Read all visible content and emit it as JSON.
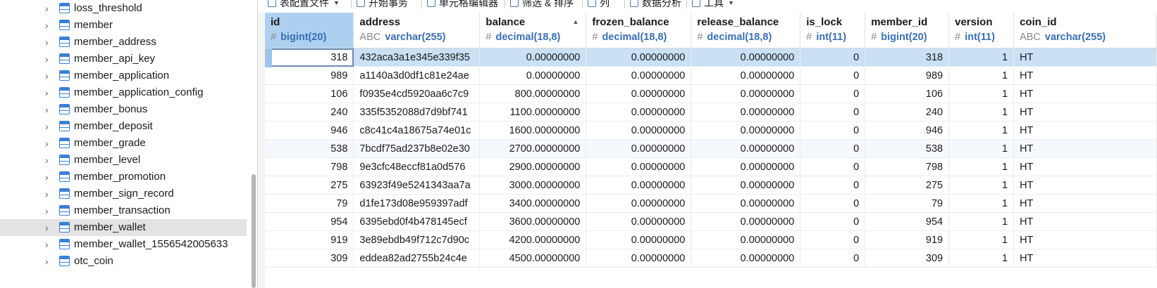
{
  "sidebar": {
    "items": [
      {
        "label": "loss_threshold",
        "selected": false
      },
      {
        "label": "member",
        "selected": false
      },
      {
        "label": "member_address",
        "selected": false
      },
      {
        "label": "member_api_key",
        "selected": false
      },
      {
        "label": "member_application",
        "selected": false
      },
      {
        "label": "member_application_config",
        "selected": false
      },
      {
        "label": "member_bonus",
        "selected": false
      },
      {
        "label": "member_deposit",
        "selected": false
      },
      {
        "label": "member_grade",
        "selected": false
      },
      {
        "label": "member_level",
        "selected": false
      },
      {
        "label": "member_promotion",
        "selected": false
      },
      {
        "label": "member_sign_record",
        "selected": false
      },
      {
        "label": "member_transaction",
        "selected": false
      },
      {
        "label": "member_wallet",
        "selected": true
      },
      {
        "label": "member_wallet_1556542005633",
        "selected": false
      },
      {
        "label": "otc_coin",
        "selected": false
      }
    ]
  },
  "toolbar": {
    "items": [
      {
        "label": "表配置文件",
        "icon": "config-file-icon",
        "dropdown": true
      },
      {
        "label": "开始事务",
        "icon": "transaction-icon",
        "dropdown": false
      },
      {
        "label": "单元格编辑器",
        "icon": "cell-editor-icon",
        "dropdown": false
      },
      {
        "label": "筛选 & 排序",
        "icon": "filter-icon",
        "dropdown": false
      },
      {
        "label": "列",
        "icon": "columns-icon",
        "dropdown": false
      },
      {
        "label": "数据分析",
        "icon": "analysis-icon",
        "dropdown": false
      },
      {
        "label": "工具",
        "icon": "tools-icon",
        "dropdown": true
      }
    ]
  },
  "grid": {
    "columns": [
      {
        "name": "id",
        "type": "bigint(20)",
        "type_icon": "#"
      },
      {
        "name": "address",
        "type": "varchar(255)",
        "type_icon": "ABC"
      },
      {
        "name": "balance",
        "type": "decimal(18,8)",
        "type_icon": "#",
        "sorted": "asc"
      },
      {
        "name": "frozen_balance",
        "type": "decimal(18,8)",
        "type_icon": "#"
      },
      {
        "name": "release_balance",
        "type": "decimal(18,8)",
        "type_icon": "#"
      },
      {
        "name": "is_lock",
        "type": "int(11)",
        "type_icon": "#"
      },
      {
        "name": "member_id",
        "type": "bigint(20)",
        "type_icon": "#"
      },
      {
        "name": "version",
        "type": "int(11)",
        "type_icon": "#"
      },
      {
        "name": "coin_id",
        "type": "varchar(255)",
        "type_icon": "ABC"
      }
    ],
    "rows": [
      [
        "318",
        "432aca3a1e345e339f35",
        "0.00000000",
        "0.00000000",
        "0.00000000",
        "0",
        "318",
        "1",
        "HT"
      ],
      [
        "989",
        "a1140a3d0df1c81e24ae",
        "0.00000000",
        "0.00000000",
        "0.00000000",
        "0",
        "989",
        "1",
        "HT"
      ],
      [
        "106",
        "f0935e4cd5920aa6c7c9",
        "800.00000000",
        "0.00000000",
        "0.00000000",
        "0",
        "106",
        "1",
        "HT"
      ],
      [
        "240",
        "335f5352088d7d9bf741",
        "1100.00000000",
        "0.00000000",
        "0.00000000",
        "0",
        "240",
        "1",
        "HT"
      ],
      [
        "946",
        "c8c41c4a18675a74e01c",
        "1600.00000000",
        "0.00000000",
        "0.00000000",
        "0",
        "946",
        "1",
        "HT"
      ],
      [
        "538",
        "7bcdf75ad237b8e02e30",
        "2700.00000000",
        "0.00000000",
        "0.00000000",
        "0",
        "538",
        "1",
        "HT"
      ],
      [
        "798",
        "9e3cfc48eccf81a0d576",
        "2900.00000000",
        "0.00000000",
        "0.00000000",
        "0",
        "798",
        "1",
        "HT"
      ],
      [
        "275",
        "63923f49e5241343aa7a",
        "3000.00000000",
        "0.00000000",
        "0.00000000",
        "0",
        "275",
        "1",
        "HT"
      ],
      [
        "79",
        "d1fe173d08e959397adf",
        "3400.00000000",
        "0.00000000",
        "0.00000000",
        "0",
        "79",
        "1",
        "HT"
      ],
      [
        "954",
        "6395ebd0f4b478145ecf",
        "3600.00000000",
        "0.00000000",
        "0.00000000",
        "0",
        "954",
        "1",
        "HT"
      ],
      [
        "919",
        "3e89ebdb49f712c7d90c",
        "4200.00000000",
        "0.00000000",
        "0.00000000",
        "0",
        "919",
        "1",
        "HT"
      ],
      [
        "309",
        "eddea82ad2755b24c4e",
        "4500.00000000",
        "0.00000000",
        "0.00000000",
        "0",
        "309",
        "1",
        "HT"
      ]
    ],
    "selected_row": 0,
    "selected_column": 0
  },
  "colors": {
    "selected_row": "#c9e0f5",
    "selected_header": "#aed0f0",
    "type_text": "#3a6fb5",
    "tree_selected": "#e3e3e3"
  }
}
